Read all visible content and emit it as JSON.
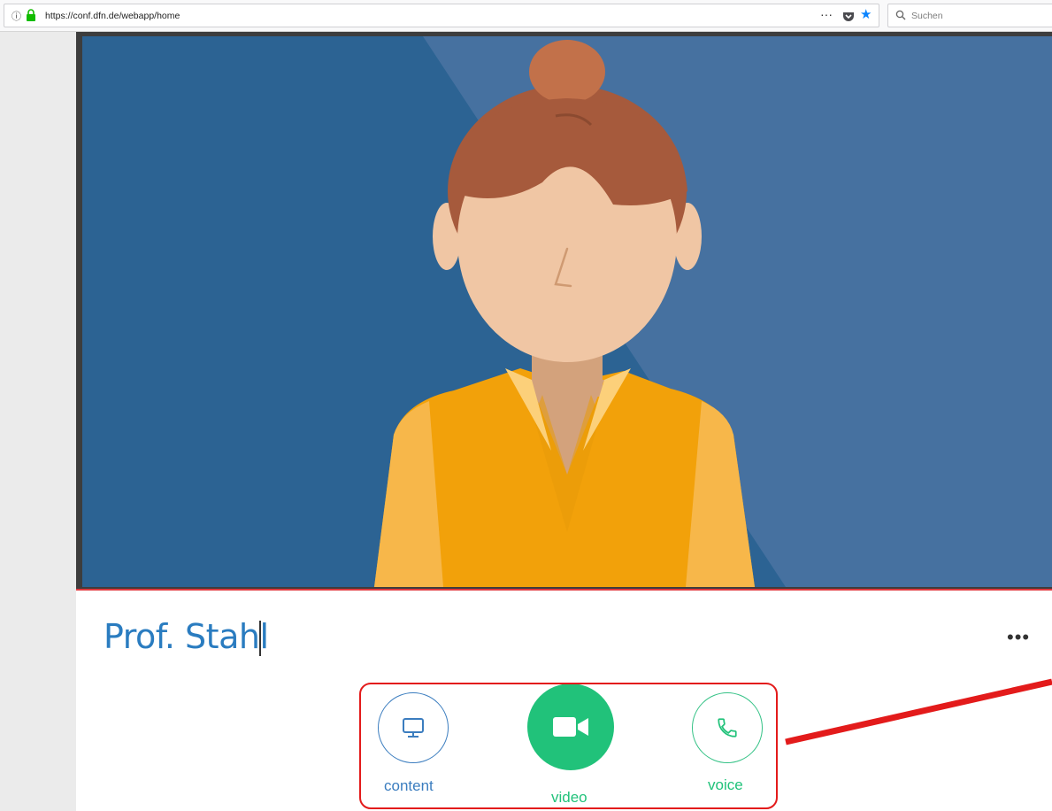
{
  "browser": {
    "url": "https://conf.dfn.de/webapp/home",
    "search_placeholder": "Suchen",
    "more_label": "···"
  },
  "call": {
    "participant_name": "Prof. Stahl",
    "more_options": "•••"
  },
  "controls": {
    "content_label": "content",
    "video_label": "video",
    "voice_label": "voice"
  },
  "colors": {
    "video_background": "#2c6393",
    "accent_green": "#21c27a",
    "accent_blue": "#3b7dbf",
    "annotation_red": "#e31b1b"
  },
  "icons": [
    "info-icon",
    "lock-icon",
    "pocket-icon",
    "star-icon",
    "search-icon",
    "monitor-icon",
    "video-camera-icon",
    "phone-icon"
  ]
}
